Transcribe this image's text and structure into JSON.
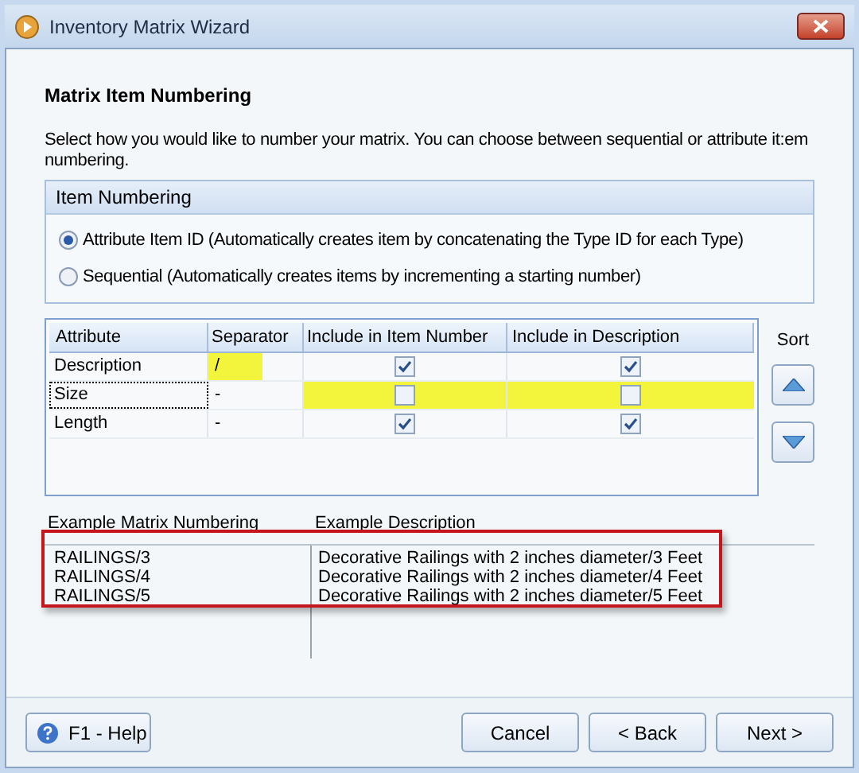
{
  "window": {
    "title": "Inventory Matrix Wizard"
  },
  "heading": "Matrix Item Numbering",
  "intro": "Select how you would like to number your matrix.  You can choose between sequential or attribute it:em numbering.",
  "numbering_group": {
    "title": "Item Numbering",
    "options": [
      {
        "label": "Attribute Item ID (Automatically creates item by concatenating the Type ID for each Type)",
        "selected": true
      },
      {
        "label": "Sequential (Automatically creates items by incrementing a starting number)",
        "selected": false
      }
    ]
  },
  "grid": {
    "columns": [
      "Attribute",
      "Separator",
      "Include in Item Number",
      "Include in Description"
    ],
    "rows": [
      {
        "attribute": "Description",
        "separator": "/",
        "in_number": true,
        "in_description": true,
        "focused": false,
        "separator_highlighted": true,
        "checks_highlighted": false
      },
      {
        "attribute": "Size",
        "separator": "-",
        "in_number": false,
        "in_description": false,
        "focused": true,
        "separator_highlighted": false,
        "checks_highlighted": true
      },
      {
        "attribute": "Length",
        "separator": "-",
        "in_number": true,
        "in_description": true,
        "focused": false,
        "separator_highlighted": false,
        "checks_highlighted": false
      }
    ]
  },
  "sort": {
    "label": "Sort"
  },
  "examples": {
    "columns": [
      "Example Matrix Numbering",
      "Example Description"
    ],
    "rows": [
      {
        "number": "RAILINGS/3",
        "description": "Decorative Railings with 2 inches diameter/3 Feet"
      },
      {
        "number": "RAILINGS/4",
        "description": "Decorative Railings with 2 inches diameter/4 Feet"
      },
      {
        "number": "RAILINGS/5",
        "description": "Decorative Railings with 2 inches diameter/5 Feet"
      }
    ]
  },
  "buttons": {
    "help": "F1 -  Help",
    "cancel": "Cancel",
    "back": "< Back",
    "next": "Next >"
  }
}
